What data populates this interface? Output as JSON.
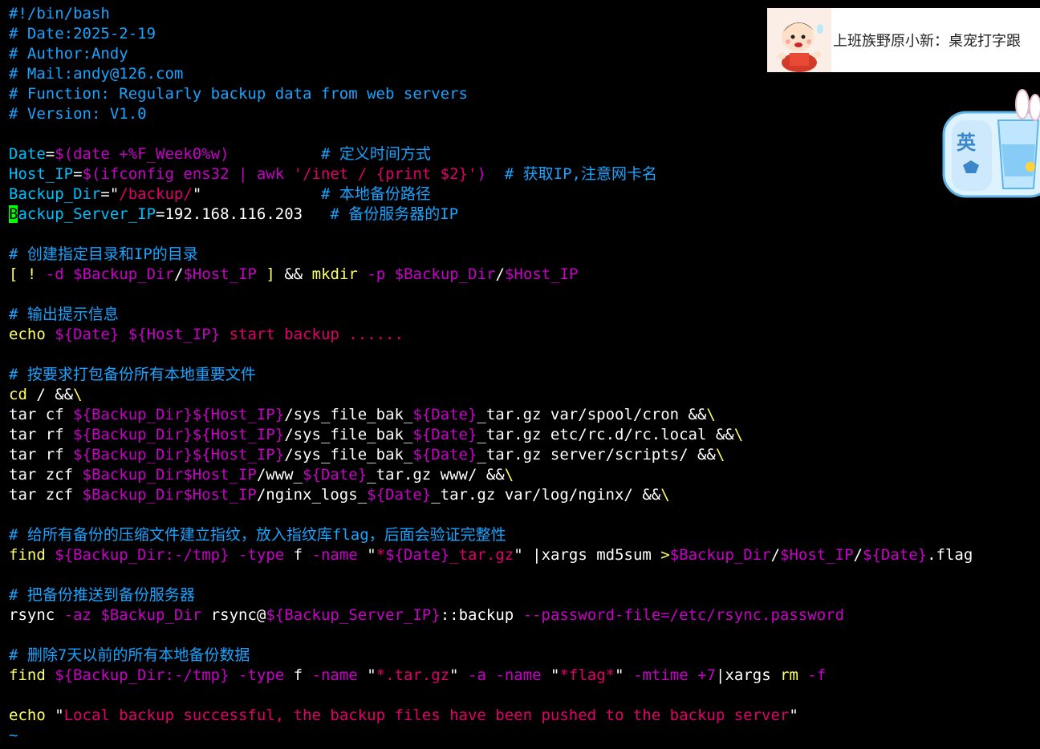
{
  "colors": {
    "comment": "#1aa3ff",
    "default": "#ffffff",
    "var": "#00bfff",
    "string": "#e0006a",
    "magenta": "#c800c8",
    "keyword": "#ffff66",
    "cursor": "#00ff00",
    "tilde": "#1aa3ff"
  },
  "overlay": {
    "title": "上班族野原小新：桌宠打字跟",
    "avatar_icon": "cartoon-boy-avatar-icon",
    "pet_icon": "desktop-pet-cup-icon",
    "pet_badge": "英"
  },
  "editor": {
    "lines": [
      [
        {
          "t": "#!/bin/bash",
          "c": "comment"
        }
      ],
      [
        {
          "t": "# Date:2025-2-19",
          "c": "comment"
        }
      ],
      [
        {
          "t": "# Author:Andy",
          "c": "comment"
        }
      ],
      [
        {
          "t": "# Mail:andy@126.com",
          "c": "comment"
        }
      ],
      [
        {
          "t": "# Function: Regularly backup data from web servers",
          "c": "comment"
        }
      ],
      [
        {
          "t": "# Version: V1.0",
          "c": "comment"
        }
      ],
      [],
      [
        {
          "t": "Date",
          "c": "var"
        },
        {
          "t": "=",
          "c": "default"
        },
        {
          "t": "$(date +%F_Week0%w)",
          "c": "magenta"
        },
        {
          "t": "          ",
          "c": "default"
        },
        {
          "t": "# 定义时间方式",
          "c": "comment"
        }
      ],
      [
        {
          "t": "Host_IP",
          "c": "var"
        },
        {
          "t": "=",
          "c": "default"
        },
        {
          "t": "$(ifconfig ens32 | awk ",
          "c": "magenta"
        },
        {
          "t": "'/inet / {print $2}'",
          "c": "string"
        },
        {
          "t": ")",
          "c": "magenta"
        },
        {
          "t": "  ",
          "c": "default"
        },
        {
          "t": "# 获取IP,注意网卡名",
          "c": "comment"
        }
      ],
      [
        {
          "t": "Backup_Dir",
          "c": "var"
        },
        {
          "t": "=",
          "c": "default"
        },
        {
          "t": "\"",
          "c": "default"
        },
        {
          "t": "/backup/",
          "c": "string"
        },
        {
          "t": "\"",
          "c": "default"
        },
        {
          "t": "             ",
          "c": "default"
        },
        {
          "t": "# 本地备份路径",
          "c": "comment"
        }
      ],
      [
        {
          "t": "B",
          "c": "cursor"
        },
        {
          "t": "ackup_Server_IP",
          "c": "var"
        },
        {
          "t": "=192.168.116.203",
          "c": "default"
        },
        {
          "t": "   ",
          "c": "default"
        },
        {
          "t": "# 备份服务器的IP",
          "c": "comment"
        }
      ],
      [],
      [
        {
          "t": "# 创建指定目录和IP的目录",
          "c": "comment"
        }
      ],
      [
        {
          "t": "[",
          "c": "keyword"
        },
        {
          "t": " ",
          "c": "default"
        },
        {
          "t": "!",
          "c": "keyword"
        },
        {
          "t": " ",
          "c": "default"
        },
        {
          "t": "-d",
          "c": "magenta"
        },
        {
          "t": " ",
          "c": "default"
        },
        {
          "t": "$Backup_Dir",
          "c": "magenta"
        },
        {
          "t": "/",
          "c": "default"
        },
        {
          "t": "$Host_IP",
          "c": "magenta"
        },
        {
          "t": " ",
          "c": "default"
        },
        {
          "t": "]",
          "c": "keyword"
        },
        {
          "t": " && ",
          "c": "default"
        },
        {
          "t": "mkdir",
          "c": "keyword"
        },
        {
          "t": " ",
          "c": "default"
        },
        {
          "t": "-p",
          "c": "magenta"
        },
        {
          "t": " ",
          "c": "default"
        },
        {
          "t": "$Backup_Dir",
          "c": "magenta"
        },
        {
          "t": "/",
          "c": "default"
        },
        {
          "t": "$Host_IP",
          "c": "magenta"
        }
      ],
      [],
      [
        {
          "t": "# 输出提示信息",
          "c": "comment"
        }
      ],
      [
        {
          "t": "echo",
          "c": "keyword"
        },
        {
          "t": " ",
          "c": "default"
        },
        {
          "t": "${Date}",
          "c": "magenta"
        },
        {
          "t": " ",
          "c": "default"
        },
        {
          "t": "${Host_IP}",
          "c": "magenta"
        },
        {
          "t": " start backup ......",
          "c": "string"
        }
      ],
      [],
      [
        {
          "t": "# 按要求打包备份所有本地重要文件",
          "c": "comment"
        }
      ],
      [
        {
          "t": "cd",
          "c": "keyword"
        },
        {
          "t": " / &&",
          "c": "default"
        },
        {
          "t": "\\",
          "c": "keyword"
        }
      ],
      [
        {
          "t": "tar cf ",
          "c": "default"
        },
        {
          "t": "${Backup_Dir}${Host_IP}",
          "c": "magenta"
        },
        {
          "t": "/sys_file_bak_",
          "c": "default"
        },
        {
          "t": "${Date}",
          "c": "magenta"
        },
        {
          "t": "_tar.gz var/spool/cron &&",
          "c": "default"
        },
        {
          "t": "\\",
          "c": "keyword"
        }
      ],
      [
        {
          "t": "tar rf ",
          "c": "default"
        },
        {
          "t": "${Backup_Dir}${Host_IP}",
          "c": "magenta"
        },
        {
          "t": "/sys_file_bak_",
          "c": "default"
        },
        {
          "t": "${Date}",
          "c": "magenta"
        },
        {
          "t": "_tar.gz etc/rc.d/rc.local &&",
          "c": "default"
        },
        {
          "t": "\\",
          "c": "keyword"
        }
      ],
      [
        {
          "t": "tar rf ",
          "c": "default"
        },
        {
          "t": "${Backup_Dir}${Host_IP}",
          "c": "magenta"
        },
        {
          "t": "/sys_file_bak_",
          "c": "default"
        },
        {
          "t": "${Date}",
          "c": "magenta"
        },
        {
          "t": "_tar.gz server/scripts/ &&",
          "c": "default"
        },
        {
          "t": "\\",
          "c": "keyword"
        }
      ],
      [
        {
          "t": "tar zcf ",
          "c": "default"
        },
        {
          "t": "$Backup_Dir$Host_IP",
          "c": "magenta"
        },
        {
          "t": "/www_",
          "c": "default"
        },
        {
          "t": "${Date}",
          "c": "magenta"
        },
        {
          "t": "_tar.gz www/ &&",
          "c": "default"
        },
        {
          "t": "\\",
          "c": "keyword"
        }
      ],
      [
        {
          "t": "tar zcf ",
          "c": "default"
        },
        {
          "t": "$Backup_Dir$Host_IP",
          "c": "magenta"
        },
        {
          "t": "/nginx_logs_",
          "c": "default"
        },
        {
          "t": "${Date}",
          "c": "magenta"
        },
        {
          "t": "_tar.gz var/log/nginx/ &&",
          "c": "default"
        },
        {
          "t": "\\",
          "c": "keyword"
        }
      ],
      [],
      [
        {
          "t": "# 给所有备份的压缩文件建立指纹，放入指纹库flag，后面会验证完整性",
          "c": "comment"
        }
      ],
      [
        {
          "t": "find",
          "c": "keyword"
        },
        {
          "t": " ",
          "c": "default"
        },
        {
          "t": "${Backup_Dir:-/tmp}",
          "c": "magenta"
        },
        {
          "t": " ",
          "c": "default"
        },
        {
          "t": "-type",
          "c": "magenta"
        },
        {
          "t": " f ",
          "c": "default"
        },
        {
          "t": "-name",
          "c": "magenta"
        },
        {
          "t": " \"",
          "c": "default"
        },
        {
          "t": "*",
          "c": "string"
        },
        {
          "t": "${Date}",
          "c": "magenta"
        },
        {
          "t": "_tar.gz",
          "c": "string"
        },
        {
          "t": "\" |xargs md5sum ",
          "c": "default"
        },
        {
          "t": ">",
          "c": "keyword"
        },
        {
          "t": "$Backup_Dir",
          "c": "magenta"
        },
        {
          "t": "/",
          "c": "default"
        },
        {
          "t": "$Host_IP",
          "c": "magenta"
        },
        {
          "t": "/",
          "c": "default"
        },
        {
          "t": "${Date}",
          "c": "magenta"
        },
        {
          "t": ".flag",
          "c": "default"
        }
      ],
      [],
      [
        {
          "t": "# 把备份推送到备份服务器",
          "c": "comment"
        }
      ],
      [
        {
          "t": "rsync ",
          "c": "default"
        },
        {
          "t": "-az",
          "c": "magenta"
        },
        {
          "t": " ",
          "c": "default"
        },
        {
          "t": "$Backup_Dir",
          "c": "magenta"
        },
        {
          "t": " rsync@",
          "c": "default"
        },
        {
          "t": "${Backup_Server_IP}",
          "c": "magenta"
        },
        {
          "t": "::backup ",
          "c": "default"
        },
        {
          "t": "--password-file=/etc/rsync.password",
          "c": "magenta"
        }
      ],
      [],
      [
        {
          "t": "# 删除7天以前的所有本地备份数据",
          "c": "comment"
        }
      ],
      [
        {
          "t": "find",
          "c": "keyword"
        },
        {
          "t": " ",
          "c": "default"
        },
        {
          "t": "${Backup_Dir:-/tmp}",
          "c": "magenta"
        },
        {
          "t": " ",
          "c": "default"
        },
        {
          "t": "-type",
          "c": "magenta"
        },
        {
          "t": " f ",
          "c": "default"
        },
        {
          "t": "-name",
          "c": "magenta"
        },
        {
          "t": " \"",
          "c": "default"
        },
        {
          "t": "*.tar.gz",
          "c": "string"
        },
        {
          "t": "\" ",
          "c": "default"
        },
        {
          "t": "-a",
          "c": "magenta"
        },
        {
          "t": " ",
          "c": "default"
        },
        {
          "t": "-name",
          "c": "magenta"
        },
        {
          "t": " \"",
          "c": "default"
        },
        {
          "t": "*flag*",
          "c": "string"
        },
        {
          "t": "\" ",
          "c": "default"
        },
        {
          "t": "-mtime",
          "c": "magenta"
        },
        {
          "t": " ",
          "c": "default"
        },
        {
          "t": "+7",
          "c": "magenta"
        },
        {
          "t": "|xargs ",
          "c": "default"
        },
        {
          "t": "rm",
          "c": "keyword"
        },
        {
          "t": " ",
          "c": "default"
        },
        {
          "t": "-f",
          "c": "magenta"
        }
      ],
      [],
      [
        {
          "t": "echo",
          "c": "keyword"
        },
        {
          "t": " \"",
          "c": "default"
        },
        {
          "t": "Local backup successful, the backup files have been pushed to the backup server",
          "c": "string"
        },
        {
          "t": "\"",
          "c": "default"
        }
      ],
      [
        {
          "t": "~",
          "c": "tilde"
        }
      ]
    ]
  }
}
